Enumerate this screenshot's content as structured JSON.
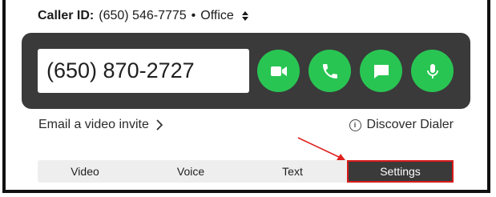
{
  "caller_id": {
    "label": "Caller ID:",
    "number": "(650) 546-7775",
    "separator": "•",
    "line": "Office"
  },
  "dialer": {
    "phone_value": "(650) 870-2727",
    "buttons": [
      {
        "name": "video-call-button",
        "icon": "video-camera-icon"
      },
      {
        "name": "voice-call-button",
        "icon": "phone-icon"
      },
      {
        "name": "text-message-button",
        "icon": "chat-bubble-icon"
      },
      {
        "name": "microphone-button",
        "icon": "microphone-icon"
      }
    ],
    "accent_color": "#29c553",
    "panel_color": "#3a3a3a"
  },
  "links": {
    "email_invite": "Email a video invite",
    "discover": "Discover Dialer"
  },
  "tabs": {
    "items": [
      {
        "label": "Video"
      },
      {
        "label": "Voice"
      },
      {
        "label": "Text"
      },
      {
        "label": "Settings"
      }
    ],
    "active": "Settings",
    "highlight_color": "#d81b1b"
  }
}
